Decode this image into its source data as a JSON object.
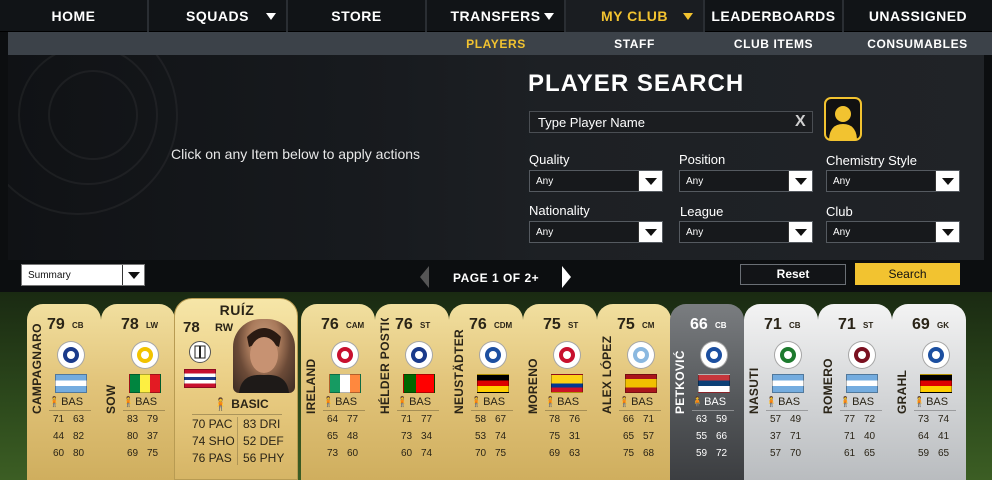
{
  "nav": {
    "items": [
      {
        "label": "HOME",
        "caret": false,
        "active": false
      },
      {
        "label": "SQUADS",
        "caret": true,
        "active": false
      },
      {
        "label": "STORE",
        "caret": false,
        "active": false
      },
      {
        "label": "TRANSFERS",
        "caret": true,
        "active": false
      },
      {
        "label": "MY CLUB",
        "caret": true,
        "active": true
      },
      {
        "label": "LEADERBOARDS",
        "caret": false,
        "active": false
      },
      {
        "label": "UNASSIGNED",
        "caret": false,
        "active": false
      }
    ]
  },
  "subnav": {
    "items": [
      {
        "label": "PLAYERS",
        "active": true
      },
      {
        "label": "STAFF",
        "active": false
      },
      {
        "label": "CLUB ITEMS",
        "active": false
      },
      {
        "label": "CONSUMABLES",
        "active": false
      }
    ]
  },
  "panel": {
    "hint": "Click on any Item below to apply actions"
  },
  "search": {
    "title": "PLAYER SEARCH",
    "name_value": "Type Player Name",
    "clear": "X",
    "filters": {
      "quality": {
        "label": "Quality",
        "value": "Any"
      },
      "position": {
        "label": "Position",
        "value": "Any"
      },
      "chemistry": {
        "label": "Chemistry Style",
        "value": "Any"
      },
      "nationality": {
        "label": "Nationality",
        "value": "Any"
      },
      "league": {
        "label": "League",
        "value": "Any"
      },
      "club": {
        "label": "Club",
        "value": "Any"
      }
    },
    "reset_label": "Reset",
    "search_label": "Search"
  },
  "list": {
    "view": "Summary",
    "pager": "PAGE 1 OF 2+"
  },
  "featured": {
    "name": "RUÍZ",
    "rating": "78",
    "position": "RW",
    "chem": "BASIC",
    "stats": [
      "70 PAC",
      "83 DRI",
      "74 SHO",
      "52 DEF",
      "76 PAS",
      "56 PHY"
    ]
  },
  "colors": {
    "accent": "#f2c330",
    "gold_card": "#e2c47a",
    "silver_card": "#d2d4d6"
  },
  "cards": [
    {
      "name": "CAMPAGNARO",
      "rating": "79",
      "pos": "CB",
      "chem": "BAS",
      "stats": [
        "71",
        "63",
        "44",
        "82",
        "60",
        "80"
      ],
      "tier": "gold"
    },
    {
      "name": "SOW",
      "rating": "78",
      "pos": "LW",
      "chem": "BAS",
      "stats": [
        "83",
        "79",
        "80",
        "37",
        "69",
        "75"
      ],
      "tier": "gold"
    },
    {
      "name": "IRELAND",
      "rating": "76",
      "pos": "CAM",
      "chem": "BAS",
      "stats": [
        "64",
        "77",
        "65",
        "48",
        "73",
        "60"
      ],
      "tier": "gold"
    },
    {
      "name": "HÉLDER POSTIGA",
      "rating": "76",
      "pos": "ST",
      "chem": "BAS",
      "stats": [
        "71",
        "77",
        "73",
        "34",
        "60",
        "74"
      ],
      "tier": "gold"
    },
    {
      "name": "NEUSTÄDTER",
      "rating": "76",
      "pos": "CDM",
      "chem": "BAS",
      "stats": [
        "58",
        "67",
        "53",
        "74",
        "70",
        "75"
      ],
      "tier": "gold"
    },
    {
      "name": "MORENO",
      "rating": "75",
      "pos": "ST",
      "chem": "BAS",
      "stats": [
        "78",
        "76",
        "75",
        "31",
        "69",
        "63"
      ],
      "tier": "gold"
    },
    {
      "name": "ALEX LÓPEZ",
      "rating": "75",
      "pos": "CM",
      "chem": "BAS",
      "stats": [
        "66",
        "71",
        "65",
        "57",
        "75",
        "68"
      ],
      "tier": "gold"
    },
    {
      "name": "PETKOVIĆ",
      "rating": "66",
      "pos": "CB",
      "chem": "BAS",
      "stats": [
        "63",
        "59",
        "55",
        "66",
        "59",
        "72"
      ],
      "tier": "dark"
    },
    {
      "name": "NASUTI",
      "rating": "71",
      "pos": "CB",
      "chem": "BAS",
      "stats": [
        "57",
        "49",
        "37",
        "71",
        "57",
        "70"
      ],
      "tier": "silver"
    },
    {
      "name": "ROMERO",
      "rating": "71",
      "pos": "ST",
      "chem": "BAS",
      "stats": [
        "77",
        "72",
        "71",
        "40",
        "61",
        "65"
      ],
      "tier": "silver"
    },
    {
      "name": "GRAHL",
      "rating": "69",
      "pos": "GK",
      "chem": "BAS",
      "stats": [
        "73",
        "74",
        "64",
        "41",
        "59",
        "65"
      ],
      "tier": "silver"
    }
  ]
}
